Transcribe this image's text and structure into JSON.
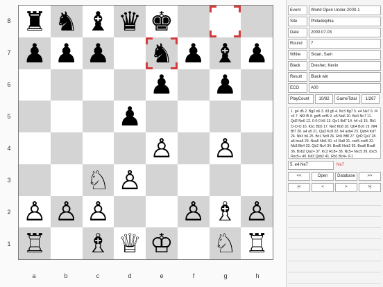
{
  "board": {
    "ranks": [
      "8",
      "7",
      "6",
      "5",
      "4",
      "3",
      "2",
      "1"
    ],
    "files": [
      "a",
      "b",
      "c",
      "d",
      "e",
      "f",
      "g",
      "h"
    ],
    "position": [
      [
        "♜",
        "♞",
        "♝",
        "♛",
        "♚",
        "",
        "",
        ""
      ],
      [
        "♟",
        "♟",
        "♟",
        "",
        "♞",
        "♟",
        "♝",
        "♟"
      ],
      [
        "",
        "",
        "",
        "",
        "♟",
        "",
        "♟",
        ""
      ],
      [
        "",
        "",
        "",
        "♟",
        "",
        "",
        "",
        ""
      ],
      [
        "",
        "",
        "",
        "",
        "♙",
        "",
        "♙",
        ""
      ],
      [
        "",
        "",
        "♘",
        "♙",
        "",
        "",
        "",
        ""
      ],
      [
        "♙",
        "♙",
        "♙",
        "",
        "",
        "♙",
        "♗",
        "♙"
      ],
      [
        "♖",
        "",
        "♗",
        "♕",
        "♔",
        "",
        "♘",
        "♖"
      ]
    ],
    "highlight": [
      [
        0,
        6
      ],
      [
        1,
        4
      ]
    ]
  },
  "game_info": [
    {
      "key": "Event",
      "value": "World Open Under-2000-1"
    },
    {
      "key": "Site",
      "value": "Philadelphia"
    },
    {
      "key": "Date",
      "value": "2000.07.03"
    },
    {
      "key": "Round",
      "value": "7"
    },
    {
      "key": "White",
      "value": "Sloan, Sam"
    },
    {
      "key": "Black",
      "value": "Dresher, Kevin"
    },
    {
      "key": "Result",
      "value": "Black win"
    },
    {
      "key": "ECO",
      "value": "A00"
    }
  ],
  "counts": {
    "play_label": "PlayCount",
    "play_value": "10/82",
    "game_label": "GameTotal",
    "game_value": "1/267"
  },
  "moves_text": "1. g4 d5 2. Bg2 e6 3. d3 g6 4. Nc3 Bg7 5. e4 Ne7 6. f4 c6 7. Nf3 f5 8. gxf5 exf5 9. e5 Na6 10. Be3 Nc7 11. Qd2 Ne6 12. 0-0-0 h5 13. Qe1 Bd7 14. h4 c5 15. Rh1 O-O-O 16. Kb1 Bb5 17. Ne2 Kb8 18. Qb4 Bc6 19. Nf4 Bf7 20. a4 a5 21. Qa3 Kc8 22. b4 axb4 23. Qxb4 Kd7 24. Nb3 b6 25. Bc1 Nc8 26. Rd1 Bf8 27. Qd2 Qa7 28. a5 bxa5 29. Nxa5 Nb6 30. c4 Ra8 31. cxd5 cxd5 32. Nb3 Bb4 33. Qb2 Nc4 34. Bxd5 Nxb2 35. Bxa8 Rxa8 36. Bxb2 Qa2+ 37. Kc2 Rc8+ 38. Nc5+ Nxc5 39. dxc5 Rxc5+ 40. Kd3 Qxb2 41. Rb1 Bc4+ 0-1",
  "current_move": "5. e4 Ne7",
  "next_move": "Ne7",
  "buttons_row1": [
    "<<",
    "Open",
    "Database",
    ">>"
  ],
  "buttons_row2": [
    "|<",
    "<",
    ">",
    ">|"
  ]
}
